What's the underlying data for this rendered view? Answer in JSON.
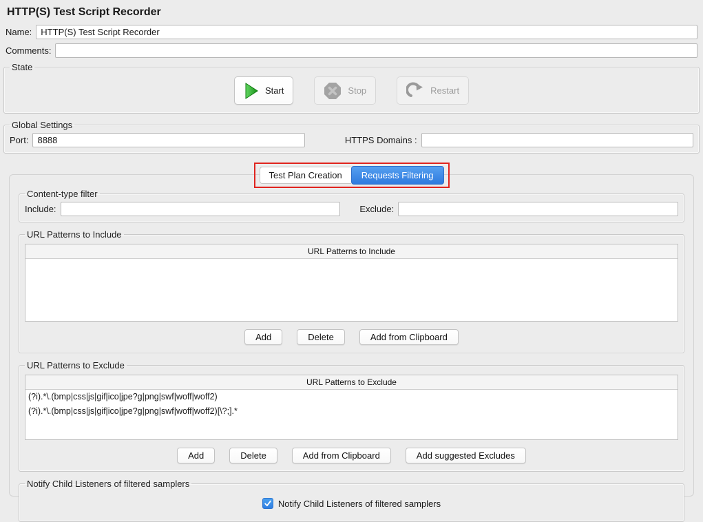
{
  "page": {
    "title": "HTTP(S) Test Script Recorder"
  },
  "fields": {
    "name_label": "Name:",
    "name_value": "HTTP(S) Test Script Recorder",
    "comments_label": "Comments:",
    "comments_value": ""
  },
  "state": {
    "legend": "State",
    "start_label": "Start",
    "stop_label": "Stop",
    "restart_label": "Restart"
  },
  "global_settings": {
    "legend": "Global Settings",
    "port_label": "Port:",
    "port_value": "8888",
    "https_domains_label": "HTTPS Domains :",
    "https_domains_value": ""
  },
  "tabs": {
    "items": [
      {
        "label": "Test Plan Creation",
        "active": false
      },
      {
        "label": "Requests Filtering",
        "active": true
      }
    ]
  },
  "content_type_filter": {
    "legend": "Content-type filter",
    "include_label": "Include:",
    "include_value": "",
    "exclude_label": "Exclude:",
    "exclude_value": ""
  },
  "url_include": {
    "legend": "URL Patterns to Include",
    "table_header": "URL Patterns to Include",
    "rows": [],
    "buttons": [
      "Add",
      "Delete",
      "Add from Clipboard"
    ]
  },
  "url_exclude": {
    "legend": "URL Patterns to Exclude",
    "table_header": "URL Patterns to Exclude",
    "rows": [
      "(?i).*\\.(bmp|css|js|gif|ico|jpe?g|png|swf|woff|woff2)",
      "(?i).*\\.(bmp|css|js|gif|ico|jpe?g|png|swf|woff|woff2)[\\?;].*"
    ],
    "buttons": [
      "Add",
      "Delete",
      "Add from Clipboard",
      "Add suggested Excludes"
    ]
  },
  "notify": {
    "legend": "Notify Child Listeners of filtered samplers",
    "checkbox_label": "Notify Child Listeners of filtered samplers",
    "checked": true
  },
  "colors": {
    "accent_blue": "#2e7ade",
    "annotation_red": "#e0241e",
    "start_green": "#2da32d",
    "disabled_gray": "#9d9d9d"
  }
}
